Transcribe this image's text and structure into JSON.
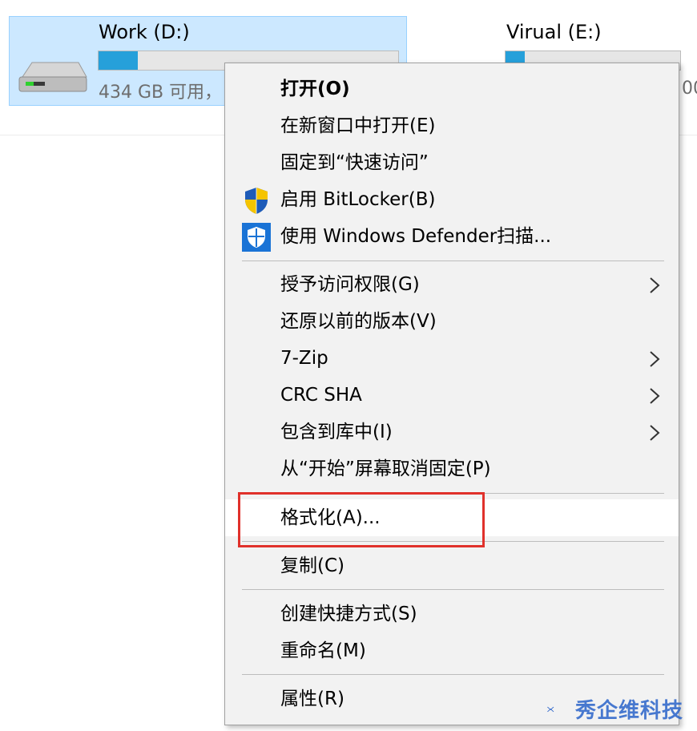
{
  "drives": [
    {
      "name": "Work (D:)",
      "free_text": "434 GB 可用，",
      "usage_fraction": 0.13
    },
    {
      "name": "Virual (E:)",
      "free_text": "00",
      "usage_fraction": 0.11
    }
  ],
  "context_menu": {
    "items": [
      {
        "label": "打开(O)",
        "bold": true
      },
      {
        "label": "在新窗口中打开(E)"
      },
      {
        "label": "固定到“快速访问”"
      },
      {
        "label": "启用 BitLocker(B)",
        "icon": "uac-shield-icon"
      },
      {
        "label": "使用 Windows Defender扫描...",
        "icon": "defender-icon"
      },
      {
        "label": "授予访问权限(G)",
        "submenu": true
      },
      {
        "label": "还原以前的版本(V)"
      },
      {
        "label": "7-Zip",
        "submenu": true
      },
      {
        "label": "CRC SHA",
        "submenu": true
      },
      {
        "label": "包含到库中(I)",
        "submenu": true
      },
      {
        "label": "从“开始”屏幕取消固定(P)"
      },
      {
        "label": "格式化(A)...",
        "highlighted": true
      },
      {
        "label": "复制(C)"
      },
      {
        "label": "创建快捷方式(S)"
      },
      {
        "label": "重命名(M)"
      },
      {
        "label": "属性(R)"
      }
    ]
  },
  "colors": {
    "accent": "#26a0da",
    "selection": "#cce8ff",
    "annotation": "#e0312b"
  },
  "watermark": {
    "text": "秀企维科技"
  }
}
